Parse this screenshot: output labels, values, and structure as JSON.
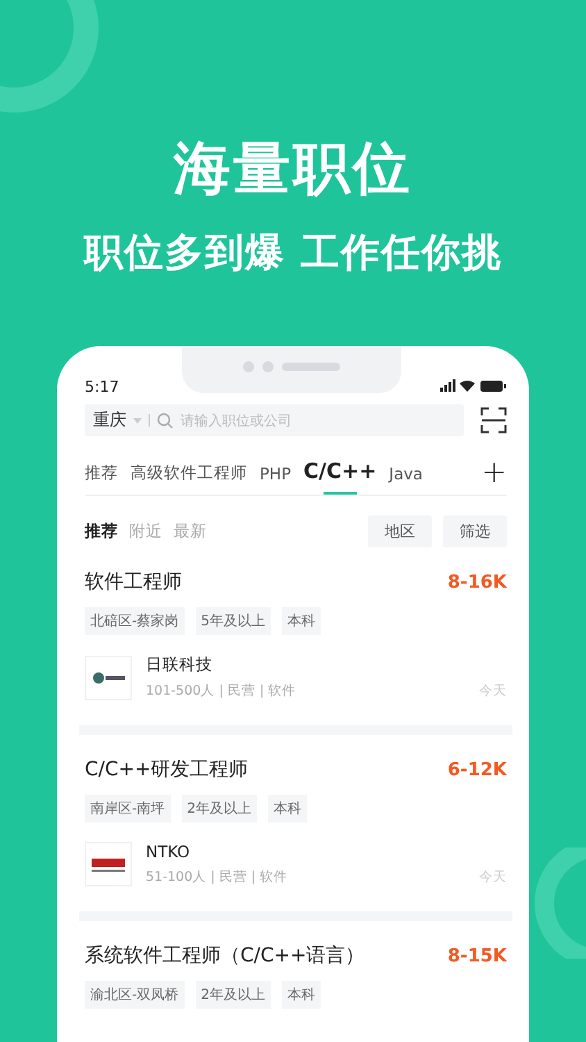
{
  "headline": "海量职位",
  "subheadline": "职位多到爆 工作任你挑",
  "status_bar": {
    "time": "5:17"
  },
  "search": {
    "city": "重庆",
    "placeholder": "请输入职位或公司"
  },
  "tabs": [
    {
      "label": "推荐",
      "selected": false
    },
    {
      "label": "高级软件工程师",
      "selected": false
    },
    {
      "label": "PHP",
      "selected": false
    },
    {
      "label": "C/C++",
      "selected": true
    },
    {
      "label": "Java",
      "selected": false
    }
  ],
  "add_tab": "+",
  "sort_options": [
    {
      "label": "推荐",
      "selected": true
    },
    {
      "label": "附近",
      "selected": false
    },
    {
      "label": "最新",
      "selected": false
    }
  ],
  "filters": [
    "地区",
    "筛选"
  ],
  "jobs": [
    {
      "title": "软件工程师",
      "salary": "8-16K",
      "tags": [
        "北碚区-蔡家岗",
        "5年及以上",
        "本科"
      ],
      "company": {
        "name": "日联科技",
        "info": "101-500人 | 民营 | 软件",
        "kind": "globe"
      },
      "posted": "今天"
    },
    {
      "title": "C/C++研发工程师",
      "salary": "6-12K",
      "tags": [
        "南岸区-南坪",
        "2年及以上",
        "本科"
      ],
      "company": {
        "name": "NTKO",
        "info": "51-100人 | 民营 | 软件",
        "kind": "bars"
      },
      "posted": "今天"
    },
    {
      "title": "系统软件工程师（C/C++语言）",
      "salary": "8-15K",
      "tags": [
        "渝北区-双凤桥",
        "2年及以上",
        "本科"
      ]
    }
  ]
}
